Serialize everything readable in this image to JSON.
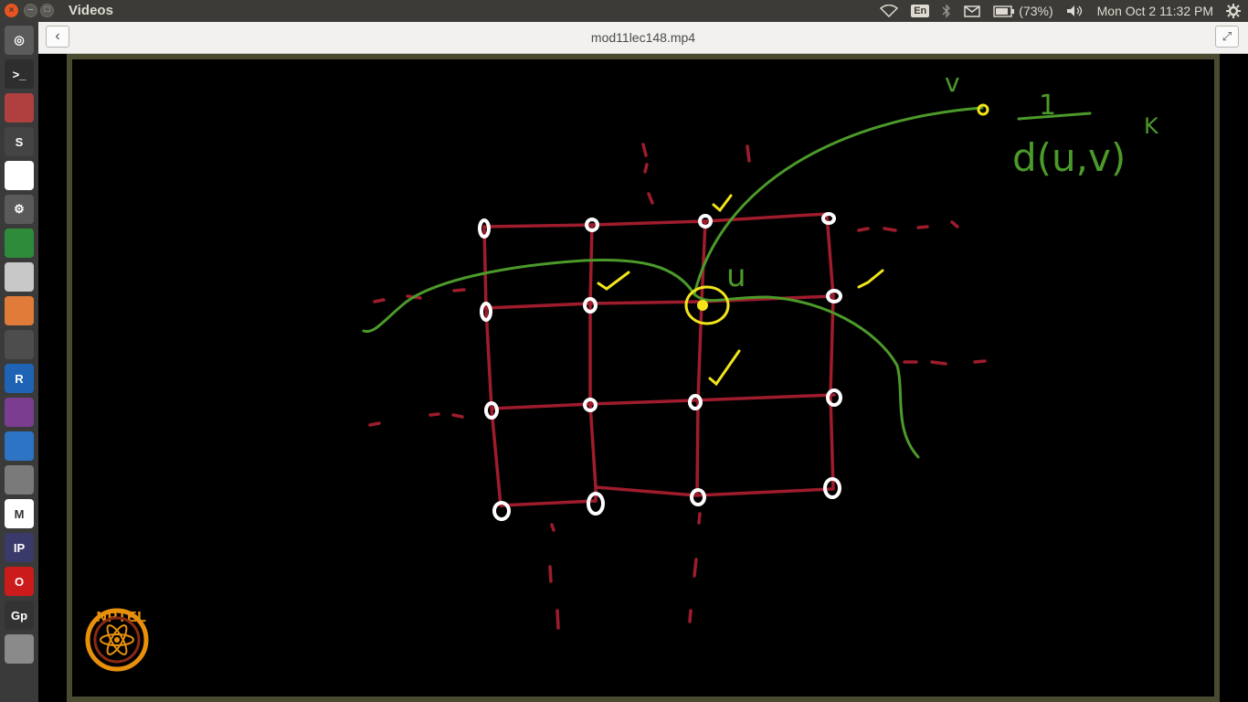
{
  "window": {
    "app_title": "Videos",
    "close_symbol": "×",
    "minimize_symbol": "–",
    "maximize_symbol": "□"
  },
  "tray": {
    "keyboard_layout": "En",
    "battery": "(73%)",
    "clock": "Mon Oct  2 11:32 PM"
  },
  "header": {
    "file_name": "mod11lec148.mp4",
    "back_symbol": "‹",
    "expand_symbol": "⤢"
  },
  "launcher": {
    "items": [
      {
        "name": "dash-icon",
        "label": "◎"
      },
      {
        "name": "terminal-icon",
        "label": ">_"
      },
      {
        "name": "files-icon",
        "label": ""
      },
      {
        "name": "sublime-icon",
        "label": "S"
      },
      {
        "name": "chrome-icon",
        "label": ""
      },
      {
        "name": "settings-icon",
        "label": "⚙"
      },
      {
        "name": "calc-icon",
        "label": ""
      },
      {
        "name": "draw-icon",
        "label": ""
      },
      {
        "name": "impress-icon",
        "label": ""
      },
      {
        "name": "video-icon",
        "label": ""
      },
      {
        "name": "r-icon",
        "label": "R"
      },
      {
        "name": "screenshot-icon",
        "label": ""
      },
      {
        "name": "writer-icon",
        "label": ""
      },
      {
        "name": "editor-icon",
        "label": ""
      },
      {
        "name": "gmail-icon",
        "label": "M"
      },
      {
        "name": "ipython-icon",
        "label": "IP"
      },
      {
        "name": "opera-icon",
        "label": "O"
      },
      {
        "name": "gp-icon",
        "label": "Gp"
      },
      {
        "name": "stack-icon",
        "label": ""
      }
    ]
  },
  "slide": {
    "logo_text": "NPTEL",
    "label_u": "u",
    "label_v": "v",
    "formula_numerator": "1",
    "formula_denominator": "d(u,v)",
    "formula_exponent": "K",
    "colors": {
      "grid": "#9e1c2c",
      "path": "#4c9a2a",
      "highlight": "#f2e51b",
      "node": "#ffffff"
    }
  }
}
